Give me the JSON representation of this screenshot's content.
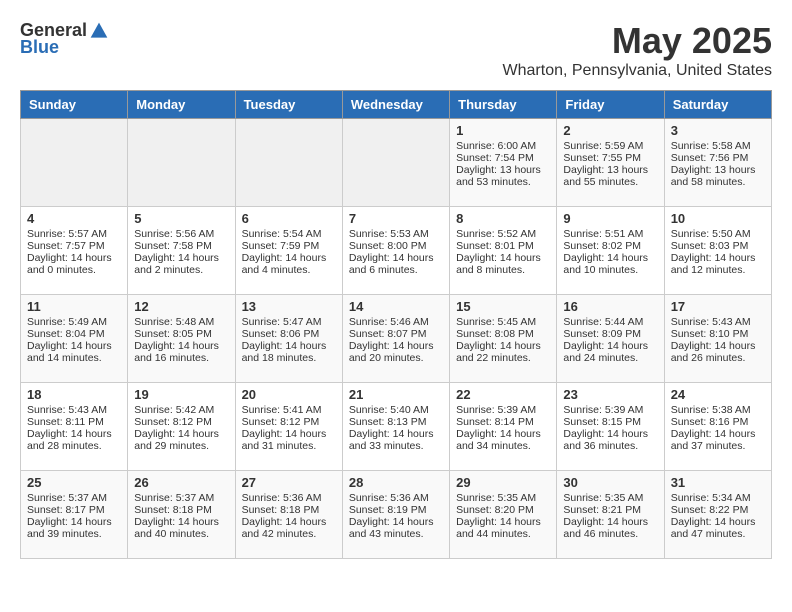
{
  "header": {
    "logo_general": "General",
    "logo_blue": "Blue",
    "month": "May 2025",
    "location": "Wharton, Pennsylvania, United States"
  },
  "days_of_week": [
    "Sunday",
    "Monday",
    "Tuesday",
    "Wednesday",
    "Thursday",
    "Friday",
    "Saturday"
  ],
  "weeks": [
    [
      {
        "day": "",
        "empty": true
      },
      {
        "day": "",
        "empty": true
      },
      {
        "day": "",
        "empty": true
      },
      {
        "day": "",
        "empty": true
      },
      {
        "day": "1",
        "line1": "Sunrise: 6:00 AM",
        "line2": "Sunset: 7:54 PM",
        "line3": "Daylight: 13 hours",
        "line4": "and 53 minutes."
      },
      {
        "day": "2",
        "line1": "Sunrise: 5:59 AM",
        "line2": "Sunset: 7:55 PM",
        "line3": "Daylight: 13 hours",
        "line4": "and 55 minutes."
      },
      {
        "day": "3",
        "line1": "Sunrise: 5:58 AM",
        "line2": "Sunset: 7:56 PM",
        "line3": "Daylight: 13 hours",
        "line4": "and 58 minutes."
      }
    ],
    [
      {
        "day": "4",
        "line1": "Sunrise: 5:57 AM",
        "line2": "Sunset: 7:57 PM",
        "line3": "Daylight: 14 hours",
        "line4": "and 0 minutes."
      },
      {
        "day": "5",
        "line1": "Sunrise: 5:56 AM",
        "line2": "Sunset: 7:58 PM",
        "line3": "Daylight: 14 hours",
        "line4": "and 2 minutes."
      },
      {
        "day": "6",
        "line1": "Sunrise: 5:54 AM",
        "line2": "Sunset: 7:59 PM",
        "line3": "Daylight: 14 hours",
        "line4": "and 4 minutes."
      },
      {
        "day": "7",
        "line1": "Sunrise: 5:53 AM",
        "line2": "Sunset: 8:00 PM",
        "line3": "Daylight: 14 hours",
        "line4": "and 6 minutes."
      },
      {
        "day": "8",
        "line1": "Sunrise: 5:52 AM",
        "line2": "Sunset: 8:01 PM",
        "line3": "Daylight: 14 hours",
        "line4": "and 8 minutes."
      },
      {
        "day": "9",
        "line1": "Sunrise: 5:51 AM",
        "line2": "Sunset: 8:02 PM",
        "line3": "Daylight: 14 hours",
        "line4": "and 10 minutes."
      },
      {
        "day": "10",
        "line1": "Sunrise: 5:50 AM",
        "line2": "Sunset: 8:03 PM",
        "line3": "Daylight: 14 hours",
        "line4": "and 12 minutes."
      }
    ],
    [
      {
        "day": "11",
        "line1": "Sunrise: 5:49 AM",
        "line2": "Sunset: 8:04 PM",
        "line3": "Daylight: 14 hours",
        "line4": "and 14 minutes."
      },
      {
        "day": "12",
        "line1": "Sunrise: 5:48 AM",
        "line2": "Sunset: 8:05 PM",
        "line3": "Daylight: 14 hours",
        "line4": "and 16 minutes."
      },
      {
        "day": "13",
        "line1": "Sunrise: 5:47 AM",
        "line2": "Sunset: 8:06 PM",
        "line3": "Daylight: 14 hours",
        "line4": "and 18 minutes."
      },
      {
        "day": "14",
        "line1": "Sunrise: 5:46 AM",
        "line2": "Sunset: 8:07 PM",
        "line3": "Daylight: 14 hours",
        "line4": "and 20 minutes."
      },
      {
        "day": "15",
        "line1": "Sunrise: 5:45 AM",
        "line2": "Sunset: 8:08 PM",
        "line3": "Daylight: 14 hours",
        "line4": "and 22 minutes."
      },
      {
        "day": "16",
        "line1": "Sunrise: 5:44 AM",
        "line2": "Sunset: 8:09 PM",
        "line3": "Daylight: 14 hours",
        "line4": "and 24 minutes."
      },
      {
        "day": "17",
        "line1": "Sunrise: 5:43 AM",
        "line2": "Sunset: 8:10 PM",
        "line3": "Daylight: 14 hours",
        "line4": "and 26 minutes."
      }
    ],
    [
      {
        "day": "18",
        "line1": "Sunrise: 5:43 AM",
        "line2": "Sunset: 8:11 PM",
        "line3": "Daylight: 14 hours",
        "line4": "and 28 minutes."
      },
      {
        "day": "19",
        "line1": "Sunrise: 5:42 AM",
        "line2": "Sunset: 8:12 PM",
        "line3": "Daylight: 14 hours",
        "line4": "and 29 minutes."
      },
      {
        "day": "20",
        "line1": "Sunrise: 5:41 AM",
        "line2": "Sunset: 8:12 PM",
        "line3": "Daylight: 14 hours",
        "line4": "and 31 minutes."
      },
      {
        "day": "21",
        "line1": "Sunrise: 5:40 AM",
        "line2": "Sunset: 8:13 PM",
        "line3": "Daylight: 14 hours",
        "line4": "and 33 minutes."
      },
      {
        "day": "22",
        "line1": "Sunrise: 5:39 AM",
        "line2": "Sunset: 8:14 PM",
        "line3": "Daylight: 14 hours",
        "line4": "and 34 minutes."
      },
      {
        "day": "23",
        "line1": "Sunrise: 5:39 AM",
        "line2": "Sunset: 8:15 PM",
        "line3": "Daylight: 14 hours",
        "line4": "and 36 minutes."
      },
      {
        "day": "24",
        "line1": "Sunrise: 5:38 AM",
        "line2": "Sunset: 8:16 PM",
        "line3": "Daylight: 14 hours",
        "line4": "and 37 minutes."
      }
    ],
    [
      {
        "day": "25",
        "line1": "Sunrise: 5:37 AM",
        "line2": "Sunset: 8:17 PM",
        "line3": "Daylight: 14 hours",
        "line4": "and 39 minutes."
      },
      {
        "day": "26",
        "line1": "Sunrise: 5:37 AM",
        "line2": "Sunset: 8:18 PM",
        "line3": "Daylight: 14 hours",
        "line4": "and 40 minutes."
      },
      {
        "day": "27",
        "line1": "Sunrise: 5:36 AM",
        "line2": "Sunset: 8:18 PM",
        "line3": "Daylight: 14 hours",
        "line4": "and 42 minutes."
      },
      {
        "day": "28",
        "line1": "Sunrise: 5:36 AM",
        "line2": "Sunset: 8:19 PM",
        "line3": "Daylight: 14 hours",
        "line4": "and 43 minutes."
      },
      {
        "day": "29",
        "line1": "Sunrise: 5:35 AM",
        "line2": "Sunset: 8:20 PM",
        "line3": "Daylight: 14 hours",
        "line4": "and 44 minutes."
      },
      {
        "day": "30",
        "line1": "Sunrise: 5:35 AM",
        "line2": "Sunset: 8:21 PM",
        "line3": "Daylight: 14 hours",
        "line4": "and 46 minutes."
      },
      {
        "day": "31",
        "line1": "Sunrise: 5:34 AM",
        "line2": "Sunset: 8:22 PM",
        "line3": "Daylight: 14 hours",
        "line4": "and 47 minutes."
      }
    ]
  ]
}
